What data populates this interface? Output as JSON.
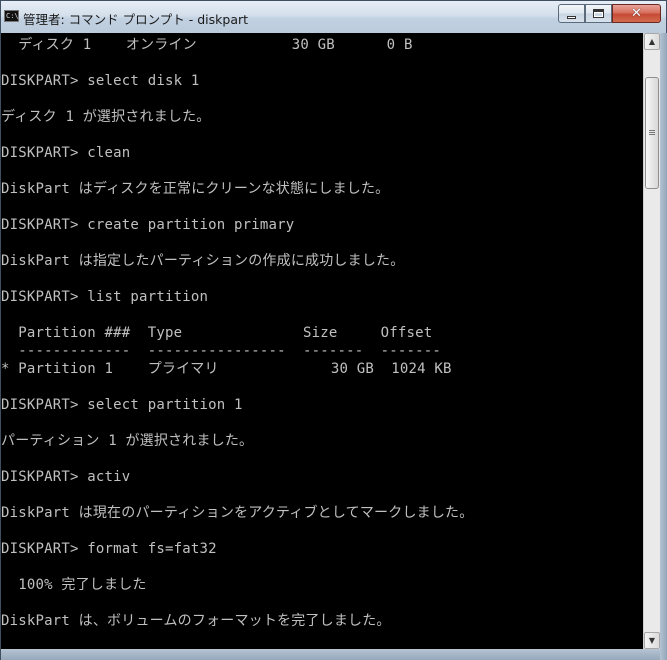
{
  "window": {
    "title": "管理者: コマンド プロンプト - diskpart",
    "icon_label": "C:\\",
    "controls": {
      "minimize": "minimize",
      "maximize": "maximize",
      "close": "✕"
    }
  },
  "console": {
    "lines": [
      "  ディスク 1    オンライン           30 GB      0 B",
      "",
      "DISKPART> select disk 1",
      "",
      "ディスク 1 が選択されました。",
      "",
      "DISKPART> clean",
      "",
      "DiskPart はディスクを正常にクリーンな状態にしました。",
      "",
      "DISKPART> create partition primary",
      "",
      "DiskPart は指定したパーティションの作成に成功しました。",
      "",
      "DISKPART> list partition",
      "",
      "  Partition ###  Type              Size     Offset",
      "  -------------  ----------------  -------  -------",
      "* Partition 1    プライマリ             30 GB  1024 KB",
      "",
      "DISKPART> select partition 1",
      "",
      "パーティション 1 が選択されました。",
      "",
      "DISKPART> activ",
      "",
      "DiskPart は現在のパーティションをアクティブとしてマークしました。",
      "",
      "DISKPART> format fs=fat32",
      "",
      "  100% 完了しました",
      "",
      "DiskPart は、ボリュームのフォーマットを完了しました。"
    ]
  },
  "colors": {
    "console_bg": "#000000",
    "console_text": "#c0c0c0"
  }
}
